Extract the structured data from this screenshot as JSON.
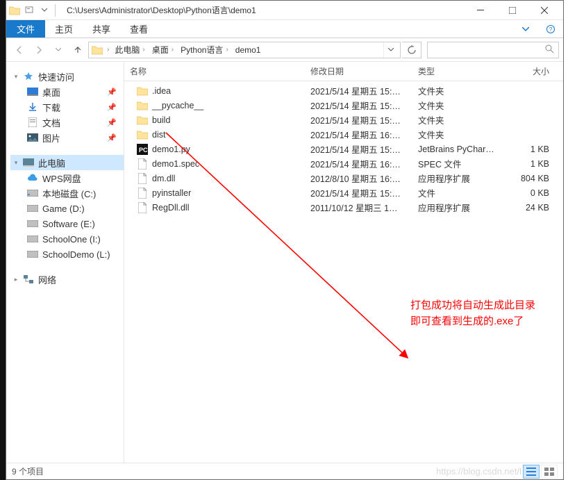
{
  "title": "C:\\Users\\Administrator\\Desktop\\Python语言\\demo1",
  "ribbon": {
    "file": "文件",
    "home": "主页",
    "share": "共享",
    "view": "查看"
  },
  "breadcrumbs": [
    "此电脑",
    "桌面",
    "Python语言",
    "demo1"
  ],
  "search_placeholder": "",
  "sidebar": {
    "quick": {
      "label": "快速访问",
      "items": [
        {
          "label": "桌面",
          "pinned": true,
          "icon": "desktop"
        },
        {
          "label": "下载",
          "pinned": true,
          "icon": "download"
        },
        {
          "label": "文档",
          "pinned": true,
          "icon": "document"
        },
        {
          "label": "图片",
          "pinned": true,
          "icon": "picture"
        }
      ]
    },
    "thispc": {
      "label": "此电脑",
      "items": [
        {
          "label": "WPS网盘",
          "icon": "cloud"
        },
        {
          "label": "本地磁盘 (C:)",
          "icon": "disk"
        },
        {
          "label": "Game (D:)",
          "icon": "disk"
        },
        {
          "label": "Software (E:)",
          "icon": "disk"
        },
        {
          "label": "SchoolOne (I:)",
          "icon": "disk"
        },
        {
          "label": "SchoolDemo (L:)",
          "icon": "disk"
        }
      ]
    },
    "network": {
      "label": "网络"
    }
  },
  "columns": {
    "name": "名称",
    "date": "修改日期",
    "type": "类型",
    "size": "大小"
  },
  "rows": [
    {
      "name": ".idea",
      "date": "2021/5/14 星期五 15:…",
      "type": "文件夹",
      "size": "",
      "icon": "folder"
    },
    {
      "name": "__pycache__",
      "date": "2021/5/14 星期五 15:…",
      "type": "文件夹",
      "size": "",
      "icon": "folder"
    },
    {
      "name": "build",
      "date": "2021/5/14 星期五 15:…",
      "type": "文件夹",
      "size": "",
      "icon": "folder"
    },
    {
      "name": "dist",
      "date": "2021/5/14 星期五 16:…",
      "type": "文件夹",
      "size": "",
      "icon": "folder"
    },
    {
      "name": "demo1.py",
      "date": "2021/5/14 星期五 15:…",
      "type": "JetBrains PyChar…",
      "size": "1 KB",
      "icon": "pycharm"
    },
    {
      "name": "demo1.spec",
      "date": "2021/5/14 星期五 16:…",
      "type": "SPEC 文件",
      "size": "1 KB",
      "icon": "file"
    },
    {
      "name": "dm.dll",
      "date": "2012/8/10 星期五 16:…",
      "type": "应用程序扩展",
      "size": "804 KB",
      "icon": "file"
    },
    {
      "name": "pyinstaller",
      "date": "2021/5/14 星期五 15:…",
      "type": "文件",
      "size": "0 KB",
      "icon": "file"
    },
    {
      "name": "RegDll.dll",
      "date": "2011/10/12 星期三 1…",
      "type": "应用程序扩展",
      "size": "24 KB",
      "icon": "file"
    }
  ],
  "annotation": {
    "line1": "打包成功将自动生成此目录",
    "line2": "即可查看到生成的.exe了"
  },
  "status": "9 个项目",
  "watermark": "https://blog.csdn.net/l"
}
